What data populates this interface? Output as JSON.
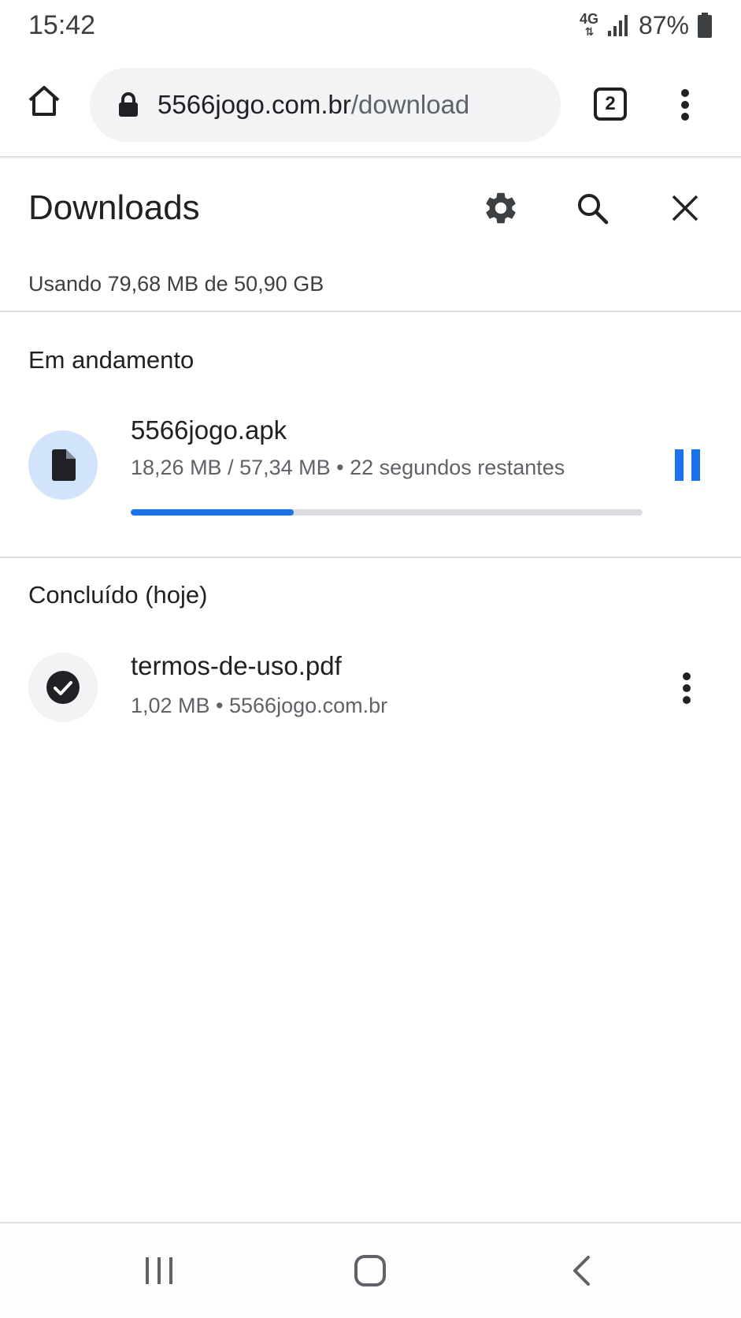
{
  "status_bar": {
    "time": "15:42",
    "network": "4G",
    "battery_percent": "87%"
  },
  "toolbar": {
    "url_host": "5566jogo.com.br",
    "url_path": "/download",
    "tab_count": "2"
  },
  "downloads": {
    "title": "Downloads",
    "storage_usage": "Usando 79,68 MB de 50,90 GB",
    "in_progress": {
      "section_title": "Em andamento",
      "items": [
        {
          "file_name": "5566jogo.apk",
          "meta": "18,26 MB / 57,34 MB • 22 segundos restantes",
          "progress_fraction": 0.318
        }
      ]
    },
    "completed": {
      "section_title": "Concluído (hoje)",
      "items": [
        {
          "file_name": "termos-de-uso.pdf",
          "meta": "1,02 MB • 5566jogo.com.br"
        }
      ]
    }
  },
  "colors": {
    "accent": "#1a73e8",
    "file_circle_active": "#d2e3fc",
    "file_circle_done": "#f1f3f4"
  },
  "icons": {
    "home": "home-icon",
    "lock": "lock-icon",
    "tabs": "tab-switcher-icon",
    "menu": "more-vert-icon",
    "settings": "gear-icon",
    "search": "search-icon",
    "close": "close-icon",
    "file": "file-icon",
    "done": "check-circle-icon",
    "pause": "pause-icon",
    "recents": "recents-icon",
    "nav_home": "nav-home-icon",
    "back": "back-icon"
  }
}
